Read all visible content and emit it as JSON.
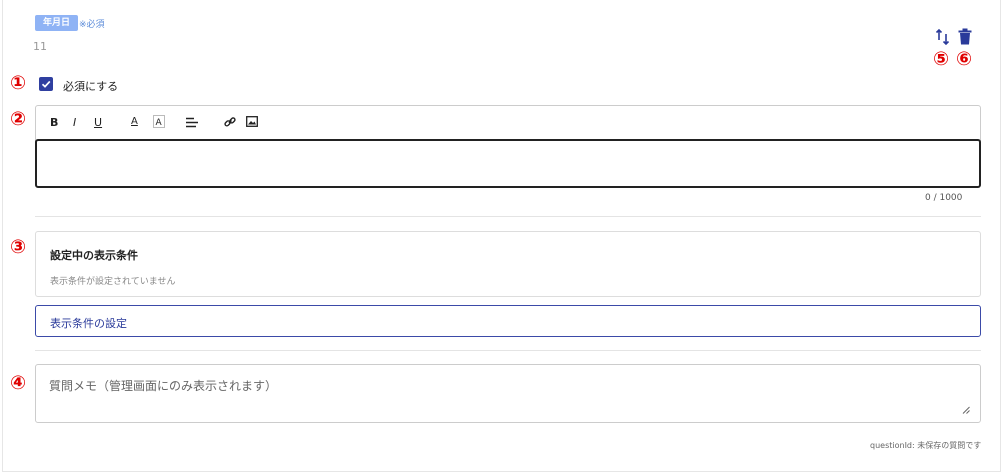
{
  "header": {
    "tag": "年月日",
    "required_note": "※必須",
    "question_number": "11"
  },
  "markers": [
    "①",
    "②",
    "③",
    "④",
    "⑤",
    "⑥"
  ],
  "required_checkbox": {
    "label": "必須にする",
    "checked": true
  },
  "editor": {
    "toolbar": [
      "B",
      "I",
      "U",
      "A"
    ],
    "value": "",
    "char_count": "0 / 1000"
  },
  "conditions": {
    "title": "設定中の表示条件",
    "empty_text": "表示条件が設定されていません",
    "button_label": "表示条件の設定"
  },
  "memo": {
    "placeholder": "質問メモ（管理画面にのみ表示されます）"
  },
  "footer": {
    "question_id": "questionId: 未保存の質問です"
  },
  "colors": {
    "accent": "#2f3fa0",
    "badge": "#8fb3f5",
    "marker": "#e00000"
  }
}
